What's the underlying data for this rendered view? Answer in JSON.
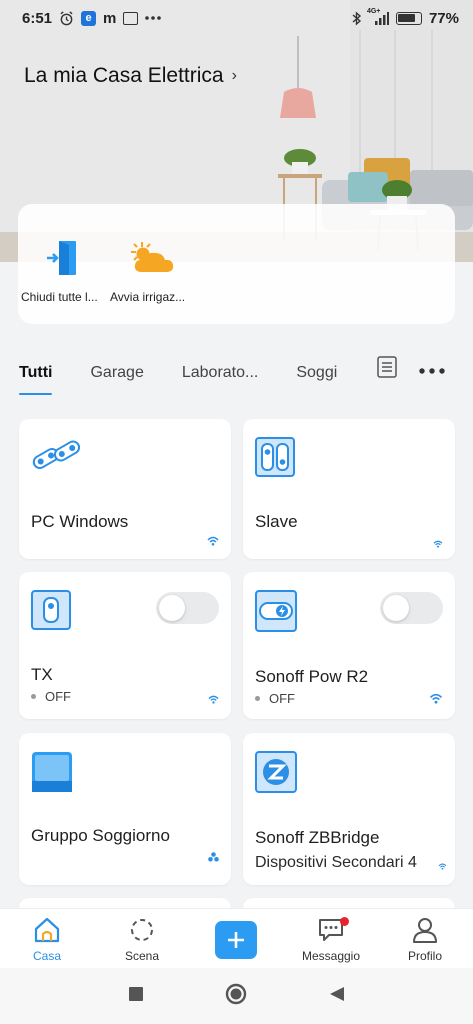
{
  "status_bar": {
    "time": "6:51",
    "network": "4G+",
    "battery": "77%",
    "battery_level": 0.77,
    "icons": [
      "alarm-icon",
      "e-app-icon",
      "m-app-icon",
      "box-app-icon",
      "more-dots-icon",
      "bluetooth-icon",
      "signal-icon",
      "battery-icon"
    ]
  },
  "header": {
    "home_name": "La mia Casa Elettrica",
    "chevron": "›"
  },
  "scenes": [
    {
      "label": "Chiudi tutte l...",
      "icon": "door-exit-icon"
    },
    {
      "label": "Avvia irrigaz...",
      "icon": "sun-cloud-icon"
    }
  ],
  "tabs": {
    "items": [
      "Tutti",
      "Garage",
      "Laborato...",
      "Soggi"
    ],
    "active": "Tutti"
  },
  "devices": [
    {
      "name": "PC Windows",
      "icon": "switch-pair-icon",
      "status_icon": "wifi-icon"
    },
    {
      "name": "Slave",
      "icon": "double-switch-icon",
      "status_icon": "wifi-icon"
    },
    {
      "name": "TX",
      "state": "OFF",
      "icon": "wall-switch-icon",
      "status_icon": "wifi-icon",
      "toggle": false
    },
    {
      "name": "Sonoff Pow R2",
      "state": "OFF",
      "icon": "power-switch-icon",
      "status_icon": "wifi-icon",
      "toggle": false
    },
    {
      "name": "Gruppo Soggiorno",
      "icon": "group-panel-icon",
      "status_icon": "group-icon"
    },
    {
      "name": "Sonoff ZBBridge",
      "sub": "Dispositivi Secondari 4",
      "icon": "zigbee-bridge-icon",
      "status_icon": "wifi-icon"
    }
  ],
  "bottom_nav": {
    "items": [
      {
        "label": "Casa",
        "icon": "home-icon",
        "active": true
      },
      {
        "label": "Scena",
        "icon": "scene-icon",
        "active": false
      },
      {
        "label": "",
        "icon": "plus-icon",
        "active": false
      },
      {
        "label": "Messaggio",
        "icon": "message-icon",
        "active": false,
        "badge": true
      },
      {
        "label": "Profilo",
        "icon": "profile-icon",
        "active": false
      }
    ]
  },
  "colors": {
    "accent": "#2b8fe6",
    "icon_blue": "#2b9cf2",
    "badge_red": "#e8232d"
  }
}
